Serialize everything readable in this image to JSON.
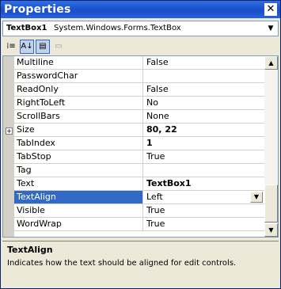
{
  "window": {
    "title": "Properties",
    "close_label": "✕"
  },
  "object_selector": {
    "name": "TextBox1",
    "type": "System.Windows.Forms.TextBox",
    "arrow": "▼"
  },
  "toolbar": {
    "buttons": [
      {
        "icon": "categorized-icon",
        "glyph": "⁞≡"
      },
      {
        "icon": "alphabetical-icon",
        "glyph": "A↓"
      },
      {
        "icon": "properties-icon",
        "glyph": "▤"
      },
      {
        "icon": "property-pages-icon",
        "glyph": "▭"
      }
    ]
  },
  "grid": {
    "rows": [
      {
        "name": "Multiline",
        "value": "False"
      },
      {
        "name": "PasswordChar",
        "value": ""
      },
      {
        "name": "ReadOnly",
        "value": "False"
      },
      {
        "name": "RightToLeft",
        "value": "No"
      },
      {
        "name": "ScrollBars",
        "value": "None"
      },
      {
        "name": "Size",
        "value": "80, 22"
      },
      {
        "name": "TabIndex",
        "value": "1"
      },
      {
        "name": "TabStop",
        "value": "True"
      },
      {
        "name": "Tag",
        "value": ""
      },
      {
        "name": "Text",
        "value": "TextBox1"
      },
      {
        "name": "TextAlign",
        "value": "Left"
      },
      {
        "name": "Visible",
        "value": "True"
      },
      {
        "name": "WordWrap",
        "value": "True"
      }
    ],
    "expander_symbol": "+",
    "dropdown_arrow": "▼",
    "scroll_up": "▲",
    "scroll_down": "▼"
  },
  "description": {
    "title": "TextAlign",
    "text": "Indicates how the text should be aligned for edit controls."
  },
  "colors": {
    "title_bar": "#1c55d1",
    "selection": "#316ac5",
    "gutter": "#d4d0c8"
  }
}
